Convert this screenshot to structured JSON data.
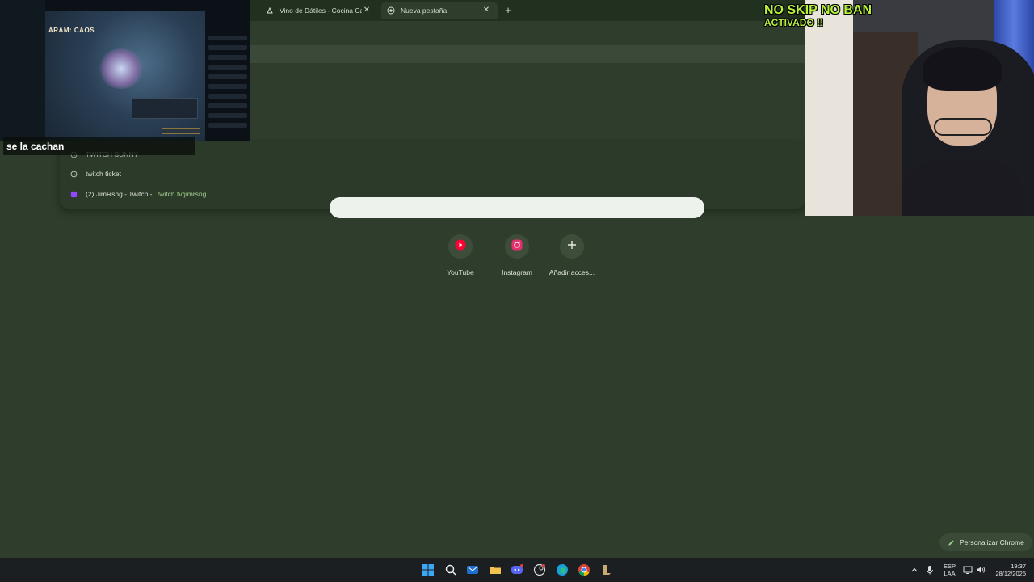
{
  "browser": {
    "tabs": [
      {
        "title": "Vino de Dátiles - Cocina Calcula",
        "icon": "recipe-icon",
        "active": false
      },
      {
        "title": "Nueva pestaña",
        "icon": "chrome-newtab-icon",
        "active": true
      }
    ],
    "close_glyph": "✕",
    "new_tab_glyph": "+"
  },
  "omnibox": {
    "suggestions": [
      {
        "text": "TWITCH SUNNY",
        "icon": "history-icon"
      },
      {
        "text": "twitch ticket",
        "icon": "history-icon"
      },
      {
        "text": "(2) JimRsng - Twitch",
        "separator": " - ",
        "url": "twitch.tv/jimrsng",
        "icon": "twitch-icon"
      }
    ]
  },
  "newtab": {
    "shortcuts": [
      {
        "label": "YouTube",
        "icon": "youtube-icon"
      },
      {
        "label": "Instagram",
        "icon": "instagram-icon"
      },
      {
        "label": "Añadir acces...",
        "icon": "plus-icon"
      }
    ],
    "customize_label": "Personalizar Chrome"
  },
  "stream_overlay": {
    "game_mode_title": "ARAM: CAOS",
    "caption": "se la cachan",
    "banner_line1": "NO SKIP NO BAN",
    "banner_line2": "ACTIVADO !!"
  },
  "taskbar": {
    "apps": [
      "windows-start-icon",
      "search-icon",
      "outlook-icon",
      "file-explorer-icon",
      "discord-icon",
      "steam-icon",
      "edge-icon",
      "chrome-icon",
      "league-client-icon"
    ],
    "lang_line1": "ESP",
    "lang_line2": "LAA",
    "time": "19:37",
    "date": "28/12/2025"
  },
  "colors": {
    "background": "#2e3d2c",
    "tabstrip": "#22301f",
    "youtube_red": "#ff0033",
    "instagram_pink": "#e1306c",
    "twitch_purple": "#9146ff",
    "banner_green": "#b6f23a"
  }
}
